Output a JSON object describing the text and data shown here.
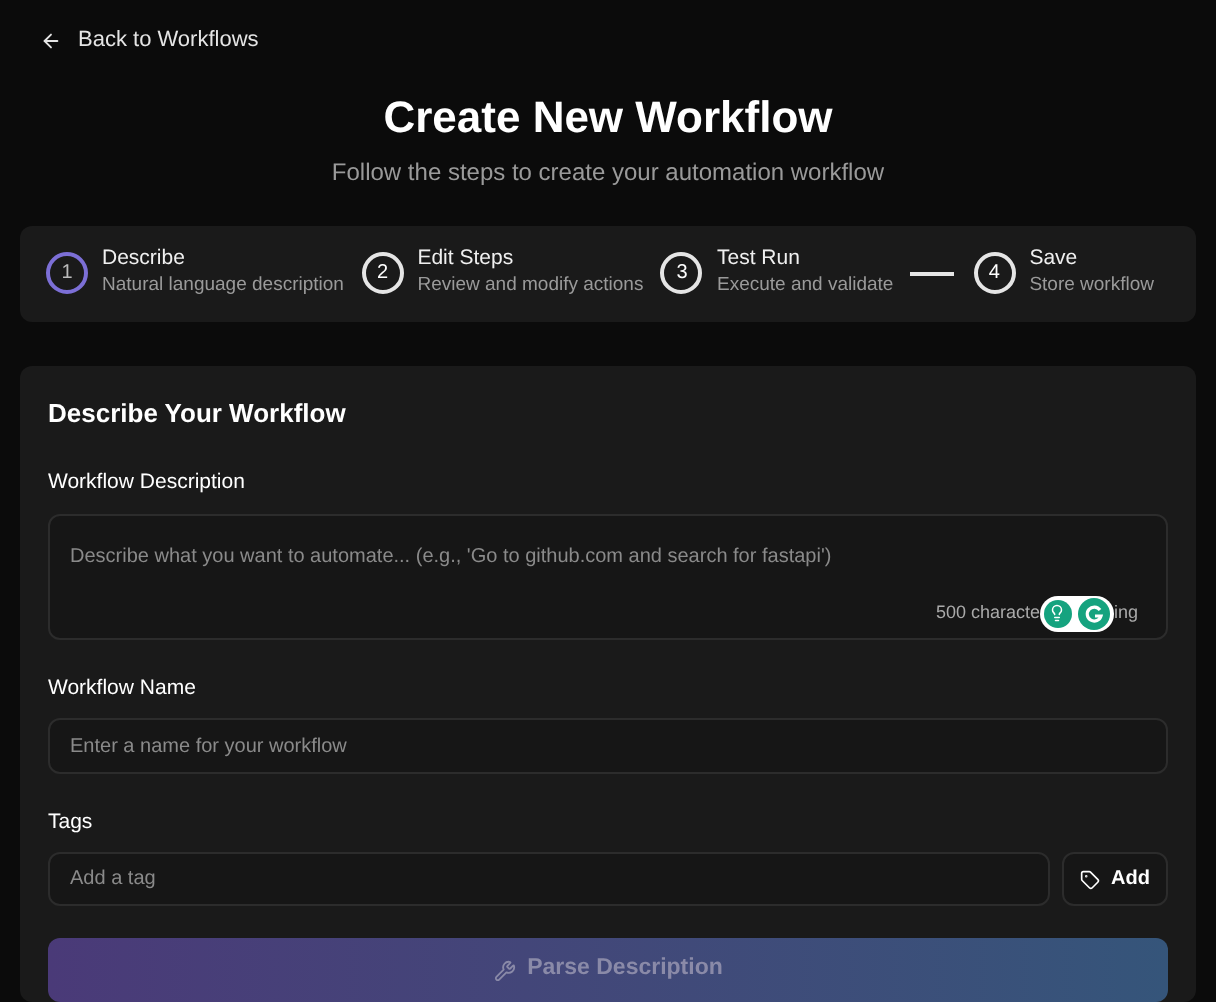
{
  "back_link": "Back to Workflows",
  "title": "Create New Workflow",
  "subtitle": "Follow the steps to create your automation workflow",
  "steps": [
    {
      "number": "1",
      "title": "Describe",
      "subtitle": "Natural language description",
      "selected": true,
      "connector_before": false
    },
    {
      "number": "2",
      "title": "Edit Steps",
      "subtitle": "Review and modify actions",
      "selected": false,
      "connector_before": false
    },
    {
      "number": "3",
      "title": "Test Run",
      "subtitle": "Execute and validate",
      "selected": false,
      "connector_before": false
    },
    {
      "number": "4",
      "title": "Save",
      "subtitle": "Store workflow",
      "selected": false,
      "connector_before": true
    }
  ],
  "form": {
    "heading": "Describe Your Workflow",
    "description": {
      "label": "Workflow Description",
      "placeholder": "Describe what you want to automate... (e.g., 'Go to github.com and search for fastapi')",
      "counter_start": "500 characte",
      "counter_end": "ing"
    },
    "name": {
      "label": "Workflow Name",
      "placeholder": "Enter a name for your workflow"
    },
    "tags": {
      "label": "Tags",
      "placeholder": "Add a tag",
      "add_button": "Add"
    },
    "submit": {
      "label": "Parse Description",
      "disabled": true
    }
  }
}
